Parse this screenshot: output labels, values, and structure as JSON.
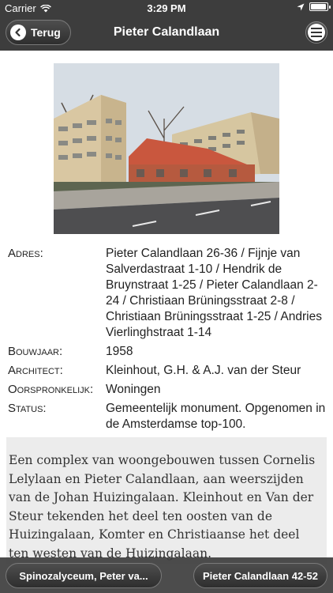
{
  "status_bar": {
    "carrier": "Carrier",
    "time": "3:29 PM"
  },
  "nav": {
    "back_label": "Terug",
    "title": "Pieter Calandlaan"
  },
  "photo": {
    "alt": "Pieter Calandlaan"
  },
  "details": [
    {
      "label": "Adres:",
      "value": "Pieter Calandlaan 26-36 / Fijnje van Salverdastraat 1-10 / Hendrik de Bruynstraat 1-25 / Pieter Calandlaan 2-24 / Christiaan Brüningsstraat 2-8 / Christiaan Brüningsstraat 1-25 / Andries Vierlinghstraat 1-14"
    },
    {
      "label": "Bouwjaar:",
      "value": "1958"
    },
    {
      "label": "Architect:",
      "value": "Kleinhout, G.H. & A.J. van der Steur"
    },
    {
      "label": "Oorspronkelijk:",
      "value": "Woningen"
    },
    {
      "label": "Status:",
      "value": "Gemeentelijk monument. Opgenomen in de Amsterdamse top-100."
    }
  ],
  "description": "Een complex van woongebouwen tussen Cornelis Lelylaan en Pieter Calandlaan, aan weerszijden van de Johan Huizingalaan. Kleinhout en Van der Steur tekenden het deel ten oosten van de Huizingalaan, Komter en Christiaanse het deel ten westen van de Huizingalaan.",
  "toolbar": {
    "prev_label": "Spinozalyceum, Peter va...",
    "next_label": "Pieter Calandlaan 42-52"
  },
  "colors": {
    "bar": "#3d3d3d",
    "description_bg": "#ececec"
  }
}
